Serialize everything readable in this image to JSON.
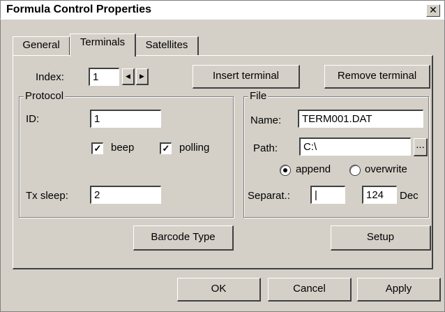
{
  "window": {
    "title": "Formula Control Properties",
    "close_symbol": "✕"
  },
  "tabs": [
    {
      "label": "General",
      "active": false
    },
    {
      "label": "Terminals",
      "active": true
    },
    {
      "label": "Satellites",
      "active": false
    }
  ],
  "index": {
    "label": "Index:",
    "value": "1"
  },
  "buttons": {
    "insert_terminal": "Insert terminal",
    "remove_terminal": "Remove terminal",
    "barcode_type": "Barcode Type",
    "setup": "Setup",
    "browse": "...",
    "ok": "OK",
    "cancel": "Cancel",
    "apply": "Apply"
  },
  "protocol": {
    "title": "Protocol",
    "id_label": "ID:",
    "id_value": "1",
    "beep_label": "beep",
    "beep_checked": true,
    "polling_label": "polling",
    "polling_checked": true,
    "tx_sleep_label": "Tx sleep:",
    "tx_sleep_value": "2"
  },
  "file": {
    "title": "File",
    "name_label": "Name:",
    "name_value": "TERM001.DAT",
    "path_label": "Path:",
    "path_value": "C:\\",
    "append_label": "append",
    "overwrite_label": "overwrite",
    "mode_selected": "append",
    "separator_label": "Separat.:",
    "separator_value": "|",
    "separator_code": "124",
    "separator_unit": "Dec"
  }
}
